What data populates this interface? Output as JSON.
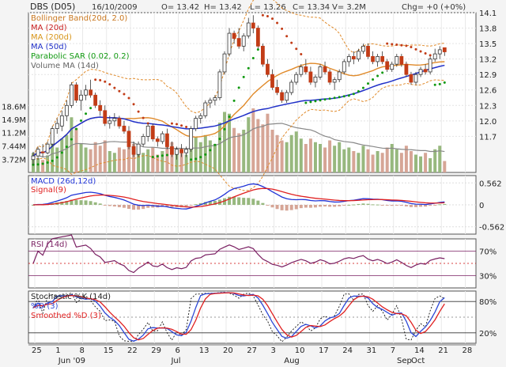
{
  "header": {
    "symbol": "DBS (D05)",
    "date": "16/10/2009",
    "open": "O= 13.42",
    "high": "H= 13.42",
    "low": "L= 13.26",
    "close": "C= 13.34",
    "volume": "V= 3.2M",
    "change": "Chg= +0 (+0%)"
  },
  "colors": {
    "up": "#3a6f3a",
    "down": "#c23c17",
    "bollinger": "#e08a2a",
    "ma20": "#c82020",
    "ma200": "#e6a020",
    "ma50": "#2030c8",
    "sar": "#119911",
    "volma": "#888888",
    "vol_up": "#97b87e",
    "vol_down": "#d6a596",
    "macd": "#2033d6",
    "signal": "#e02020",
    "rsi": "#7a1f62",
    "stochK": "#2e49d6",
    "stochD": "#e02020"
  },
  "chart_data": [
    {
      "type": "candlestick",
      "title": "DBS (D05)",
      "legend": [
        "Bollinger Band(20d, 2.0)",
        "MA (20d)",
        "MA (200d)",
        "MA (50d)",
        "Parabolic SAR (0.02, 0.2)",
        "Volume MA (14d)"
      ],
      "ylim": [
        11.0,
        14.1
      ],
      "y_ticks": [
        "14.1",
        "13.8",
        "13.5",
        "13.2",
        "12.9",
        "12.6",
        "12.3",
        "12.0",
        "11.7"
      ],
      "volume_ticks": [
        "18.6M",
        "14.9M",
        "11.2M",
        "7.44M",
        "3.72M"
      ],
      "x_tick_labels": [
        "25",
        "1",
        "8",
        "15",
        "22",
        "29",
        "6",
        "13",
        "20",
        "27",
        "3",
        "10",
        "17",
        "24",
        "31",
        "7",
        "14",
        "21",
        "28",
        "5",
        "12",
        "19",
        "26"
      ],
      "month_labels": [
        "Jun '09",
        "Jul",
        "Aug",
        "Sep",
        "Oct"
      ],
      "ohlc": [
        [
          11.25,
          11.4,
          11.15,
          11.32
        ],
        [
          11.32,
          11.5,
          11.25,
          11.45
        ],
        [
          11.4,
          11.55,
          11.3,
          11.38
        ],
        [
          11.38,
          11.6,
          11.35,
          11.55
        ],
        [
          11.55,
          11.9,
          11.5,
          11.85
        ],
        [
          11.85,
          12.05,
          11.75,
          11.95
        ],
        [
          11.9,
          12.2,
          11.8,
          12.1
        ],
        [
          12.1,
          12.4,
          12.0,
          12.3
        ],
        [
          12.3,
          12.75,
          12.25,
          12.7
        ],
        [
          12.7,
          12.75,
          12.35,
          12.4
        ],
        [
          12.4,
          12.6,
          12.2,
          12.5
        ],
        [
          12.5,
          12.7,
          12.4,
          12.6
        ],
        [
          12.6,
          12.8,
          12.45,
          12.5
        ],
        [
          12.5,
          12.55,
          12.25,
          12.3
        ],
        [
          12.3,
          12.4,
          12.1,
          12.2
        ],
        [
          12.2,
          12.3,
          11.9,
          11.95
        ],
        [
          11.95,
          12.1,
          11.85,
          12.0
        ],
        [
          12.0,
          12.15,
          11.9,
          12.05
        ],
        [
          12.05,
          12.1,
          11.85,
          11.9
        ],
        [
          11.9,
          12.0,
          11.75,
          11.8
        ],
        [
          11.8,
          11.9,
          11.45,
          11.5
        ],
        [
          11.5,
          11.6,
          11.3,
          11.35
        ],
        [
          11.35,
          11.6,
          11.3,
          11.55
        ],
        [
          11.55,
          11.75,
          11.5,
          11.7
        ],
        [
          11.7,
          11.95,
          11.6,
          11.9
        ],
        [
          11.9,
          11.95,
          11.6,
          11.65
        ],
        [
          11.65,
          11.7,
          11.5,
          11.6
        ],
        [
          11.6,
          11.8,
          11.55,
          11.75
        ],
        [
          11.75,
          11.85,
          11.45,
          11.5
        ],
        [
          11.5,
          11.6,
          11.3,
          11.35
        ],
        [
          11.35,
          11.5,
          11.25,
          11.45
        ],
        [
          11.45,
          11.55,
          11.3,
          11.38
        ],
        [
          11.38,
          11.5,
          11.3,
          11.45
        ],
        [
          11.45,
          11.9,
          11.4,
          11.85
        ],
        [
          11.85,
          12.1,
          11.8,
          12.05
        ],
        [
          12.05,
          12.15,
          11.95,
          12.1
        ],
        [
          12.1,
          12.4,
          12.05,
          12.35
        ],
        [
          12.35,
          12.45,
          12.25,
          12.4
        ],
        [
          12.4,
          12.5,
          12.3,
          12.45
        ],
        [
          12.45,
          13.0,
          12.4,
          12.95
        ],
        [
          12.95,
          13.35,
          12.9,
          13.3
        ],
        [
          13.3,
          13.8,
          13.25,
          13.7
        ],
        [
          13.7,
          13.75,
          13.5,
          13.6
        ],
        [
          13.6,
          13.8,
          13.4,
          13.45
        ],
        [
          13.45,
          13.7,
          13.35,
          13.65
        ],
        [
          13.65,
          14.0,
          13.6,
          13.9
        ],
        [
          13.9,
          14.05,
          13.7,
          13.8
        ],
        [
          13.8,
          13.85,
          13.4,
          13.45
        ],
        [
          13.45,
          13.5,
          13.05,
          13.1
        ],
        [
          13.1,
          13.2,
          12.85,
          12.9
        ],
        [
          12.9,
          13.0,
          12.6,
          12.65
        ],
        [
          12.65,
          12.8,
          12.5,
          12.55
        ],
        [
          12.55,
          12.6,
          12.35,
          12.4
        ],
        [
          12.4,
          12.6,
          12.35,
          12.55
        ],
        [
          12.55,
          12.8,
          12.5,
          12.75
        ],
        [
          12.75,
          12.95,
          12.7,
          12.9
        ],
        [
          12.9,
          13.1,
          12.85,
          13.05
        ],
        [
          13.05,
          13.2,
          12.9,
          12.95
        ],
        [
          12.95,
          13.05,
          12.7,
          12.75
        ],
        [
          12.75,
          12.9,
          12.65,
          12.85
        ],
        [
          12.85,
          13.1,
          12.8,
          13.05
        ],
        [
          13.05,
          13.15,
          12.9,
          12.95
        ],
        [
          12.95,
          13.0,
          12.7,
          12.75
        ],
        [
          12.75,
          12.85,
          12.6,
          12.8
        ],
        [
          12.8,
          13.0,
          12.75,
          12.95
        ],
        [
          12.95,
          13.2,
          12.9,
          13.15
        ],
        [
          13.15,
          13.3,
          13.05,
          13.25
        ],
        [
          13.25,
          13.35,
          13.1,
          13.2
        ],
        [
          13.2,
          13.4,
          13.15,
          13.35
        ],
        [
          13.35,
          13.5,
          13.3,
          13.45
        ],
        [
          13.45,
          13.5,
          13.2,
          13.25
        ],
        [
          13.25,
          13.35,
          13.1,
          13.15
        ],
        [
          13.15,
          13.3,
          13.05,
          13.25
        ],
        [
          13.25,
          13.35,
          13.1,
          13.15
        ],
        [
          13.15,
          13.2,
          12.95,
          13.0
        ],
        [
          13.0,
          13.15,
          12.95,
          13.1
        ],
        [
          13.1,
          13.3,
          13.05,
          13.25
        ],
        [
          13.25,
          13.3,
          13.05,
          13.1
        ],
        [
          13.1,
          13.15,
          12.85,
          12.9
        ],
        [
          12.9,
          12.95,
          12.7,
          12.75
        ],
        [
          12.75,
          12.95,
          12.7,
          12.9
        ],
        [
          12.9,
          13.05,
          12.85,
          13.0
        ],
        [
          13.0,
          13.1,
          12.9,
          12.95
        ],
        [
          12.95,
          13.25,
          12.9,
          13.2
        ],
        [
          13.2,
          13.4,
          13.15,
          13.3
        ],
        [
          13.3,
          13.45,
          13.2,
          13.38
        ],
        [
          13.42,
          13.42,
          13.26,
          13.34
        ]
      ],
      "volume_millions": [
        5.5,
        4.0,
        3.5,
        4.8,
        8.5,
        7.0,
        9.5,
        10.5,
        15.5,
        12.5,
        8.0,
        7.0,
        6.5,
        8.5,
        7.5,
        9.0,
        6.0,
        5.5,
        7.0,
        6.5,
        9.5,
        8.0,
        6.0,
        5.5,
        6.5,
        7.0,
        5.0,
        6.0,
        7.5,
        8.5,
        6.5,
        5.5,
        5.0,
        9.0,
        10.0,
        8.5,
        10.5,
        9.0,
        8.0,
        14.0,
        17.0,
        16.5,
        12.5,
        11.0,
        12.0,
        15.5,
        18.0,
        15.0,
        13.5,
        16.5,
        12.0,
        10.5,
        9.0,
        8.5,
        10.5,
        11.5,
        9.5,
        8.0,
        9.5,
        8.5,
        8.0,
        7.0,
        9.0,
        7.5,
        8.5,
        6.5,
        7.0,
        6.0,
        5.5,
        7.5,
        6.5,
        5.0,
        6.0,
        5.5,
        7.0,
        8.0,
        6.5,
        5.5,
        7.5,
        6.0,
        5.0,
        4.5,
        5.5,
        4.0,
        6.5,
        7.5,
        3.2
      ]
    },
    {
      "type": "line",
      "title": "MACD (26d,12d)",
      "series": [
        {
          "name": "Signal(9)"
        }
      ],
      "y_ticks": [
        "0.562",
        "0",
        "-0.562"
      ],
      "ylim": [
        -0.75,
        0.75
      ]
    },
    {
      "type": "line",
      "title": "RSI (14d)",
      "y_ticks": [
        "70%",
        "30%"
      ],
      "ylim": [
        10,
        90
      ]
    },
    {
      "type": "line",
      "title": "Stochastic %K (14d)",
      "series": [
        {
          "name": "%D (3)"
        },
        {
          "name": "Smoothed %D (3)"
        }
      ],
      "y_ticks": [
        "80%",
        "20%"
      ],
      "ylim": [
        0,
        100
      ]
    }
  ]
}
